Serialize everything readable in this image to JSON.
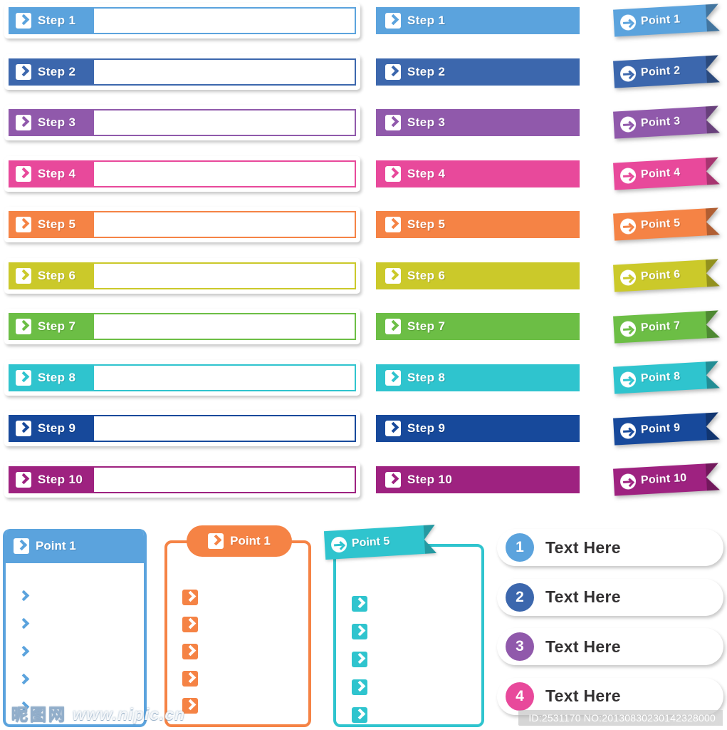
{
  "palette": {
    "c1": "#5ba3dd",
    "c2": "#3c67ad",
    "c3": "#9059ab",
    "c4": "#e8499b",
    "c5": "#f58345",
    "c6": "#cbc92a",
    "c7": "#6cbe45",
    "c8": "#2fc4ce",
    "c9": "#17499b",
    "c10": "#9e2280",
    "text_dark": "#333132"
  },
  "left_column": {
    "icon": "chevron-right-boxed-icon",
    "items": [
      {
        "label": "Step 1",
        "color": "#5ba3dd"
      },
      {
        "label": "Step 2",
        "color": "#3c67ad"
      },
      {
        "label": "Step 3",
        "color": "#9059ab"
      },
      {
        "label": "Step 4",
        "color": "#e8499b"
      },
      {
        "label": "Step 5",
        "color": "#f58345"
      },
      {
        "label": "Step 6",
        "color": "#cbc92a"
      },
      {
        "label": "Step 7",
        "color": "#6cbe45"
      },
      {
        "label": "Step 8",
        "color": "#2fc4ce"
      },
      {
        "label": "Step 9",
        "color": "#17499b"
      },
      {
        "label": "Step 10",
        "color": "#9e2280"
      }
    ]
  },
  "middle_column": {
    "icon": "chevron-right-boxed-icon",
    "items": [
      {
        "label": "Step 1",
        "color": "#5ba3dd"
      },
      {
        "label": "Step 2",
        "color": "#3c67ad"
      },
      {
        "label": "Step 3",
        "color": "#9059ab"
      },
      {
        "label": "Step 4",
        "color": "#e8499b"
      },
      {
        "label": "Step 5",
        "color": "#f58345"
      },
      {
        "label": "Step 6",
        "color": "#cbc92a"
      },
      {
        "label": "Step 7",
        "color": "#6cbe45"
      },
      {
        "label": "Step 8",
        "color": "#2fc4ce"
      },
      {
        "label": "Step 9",
        "color": "#17499b"
      },
      {
        "label": "Step 10",
        "color": "#9e2280"
      }
    ]
  },
  "right_column": {
    "icon": "arrow-right-circle-icon",
    "items": [
      {
        "label": "Point 1",
        "color": "#5ba3dd"
      },
      {
        "label": "Point 2",
        "color": "#3c67ad"
      },
      {
        "label": "Point 3",
        "color": "#9059ab"
      },
      {
        "label": "Point 4",
        "color": "#e8499b"
      },
      {
        "label": "Point 5",
        "color": "#f58345"
      },
      {
        "label": "Point 6",
        "color": "#cbc92a"
      },
      {
        "label": "Point 7",
        "color": "#6cbe45"
      },
      {
        "label": "Point 8",
        "color": "#2fc4ce"
      },
      {
        "label": "Point 9",
        "color": "#17499b"
      },
      {
        "label": "Point 10",
        "color": "#9e2280"
      }
    ]
  },
  "cards": {
    "blue": {
      "title": "Point  1",
      "color": "#5ba3dd",
      "icon": "chevron-right-boxed-icon",
      "bullet_icon": "chevron-right-icon",
      "bullet_count": 5
    },
    "orange": {
      "title": "Point  1",
      "color": "#f58345",
      "icon": "chevron-right-boxed-icon",
      "bullet_icon": "chevron-right-boxed-icon",
      "bullet_count": 5
    },
    "teal": {
      "title": "Point  5",
      "color": "#2fc4ce",
      "icon": "arrow-right-circle-icon",
      "bullet_icon": "chevron-right-boxed-icon",
      "bullet_count": 5
    }
  },
  "pill_list": {
    "items": [
      {
        "number": "1",
        "label": "Text Here",
        "color": "#5ba3dd"
      },
      {
        "number": "2",
        "label": "Text Here",
        "color": "#3c67ad"
      },
      {
        "number": "3",
        "label": "Text Here",
        "color": "#9059ab"
      },
      {
        "number": "4",
        "label": "Text Here",
        "color": "#e8499b"
      }
    ]
  },
  "watermarks": {
    "site_cn": "昵图网",
    "site_url": "www.nipic.cn",
    "id_text": "ID:2531170 NO:20130830230142328000"
  }
}
